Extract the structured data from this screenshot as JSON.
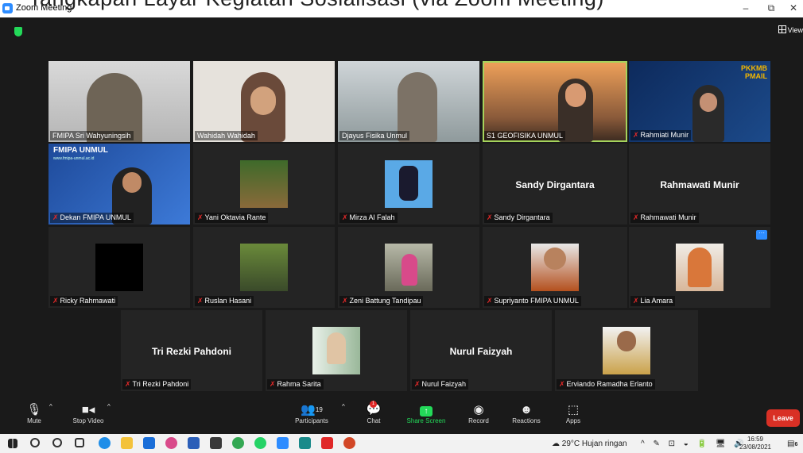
{
  "window": {
    "title": "Zoom Meeting",
    "overlay_text": "Tangkapan Layar Kegiatan Sosialisasi (via Zoom Meeting)",
    "minimize": "–",
    "restore": "⧉",
    "close": "✕"
  },
  "view_button": "View",
  "participants": [
    {
      "name": "FMIPA Sri Wahyuningsih",
      "muted": false
    },
    {
      "name": "Wahidah Wahidah",
      "muted": false
    },
    {
      "name": "Djayus Fisika Unmul",
      "muted": false
    },
    {
      "name": "S1 GEOFISIKA UNMUL",
      "muted": false
    },
    {
      "name": "Rahmiati Munir",
      "muted": true
    },
    {
      "name": "Dekan FMIPA UNMUL",
      "muted": true
    },
    {
      "name": "Yani Oktavia Rante",
      "muted": true
    },
    {
      "name": "Mirza Al Falah",
      "muted": true
    },
    {
      "name": "Sandy Dirgantara",
      "muted": true,
      "display_name": "Sandy Dirgantara"
    },
    {
      "name": "Rahmawati Munir",
      "muted": true,
      "display_name": "Rahmawati Munir"
    },
    {
      "name": "Ricky Rahmawati",
      "muted": true
    },
    {
      "name": "Ruslan Hasani",
      "muted": true
    },
    {
      "name": "Zeni Battung Tandipau",
      "muted": true
    },
    {
      "name": "Supriyanto FMIPA UNMUL",
      "muted": true
    },
    {
      "name": "Lia Amara",
      "muted": true
    },
    {
      "name": "Tri Rezki Pahdoni",
      "muted": true,
      "display_name": "Tri Rezki Pahdoni"
    },
    {
      "name": "Rahma Sarita",
      "muted": true
    },
    {
      "name": "Nurul Faizyah",
      "muted": true,
      "display_name": "Nurul Faizyah"
    },
    {
      "name": "Erviando Ramadha Erlanto",
      "muted": true
    }
  ],
  "slides": {
    "pkkmb_title": "PKKMB PMAIL",
    "fmipa_title": "FMIPA UNMUL",
    "fmipa_url": "www.fmipa-unmul.ac.id"
  },
  "toolbar": {
    "mute": "Mute",
    "stop_video": "Stop Video",
    "participants": "Participants",
    "participants_count": "19",
    "chat": "Chat",
    "chat_badge": "1",
    "share_screen": "Share Screen",
    "record": "Record",
    "reactions": "Reactions",
    "apps": "Apps",
    "leave": "Leave"
  },
  "taskbar": {
    "weather": "29°C  Hujan ringan",
    "time": "16:59",
    "date": "23/08/2021",
    "notifications": "6"
  },
  "colors": {
    "active_speaker": "#a5d35c",
    "leave": "#d93025",
    "share": "#23d959",
    "muted_mic": "#e02828",
    "accent": "#2d8cff"
  }
}
